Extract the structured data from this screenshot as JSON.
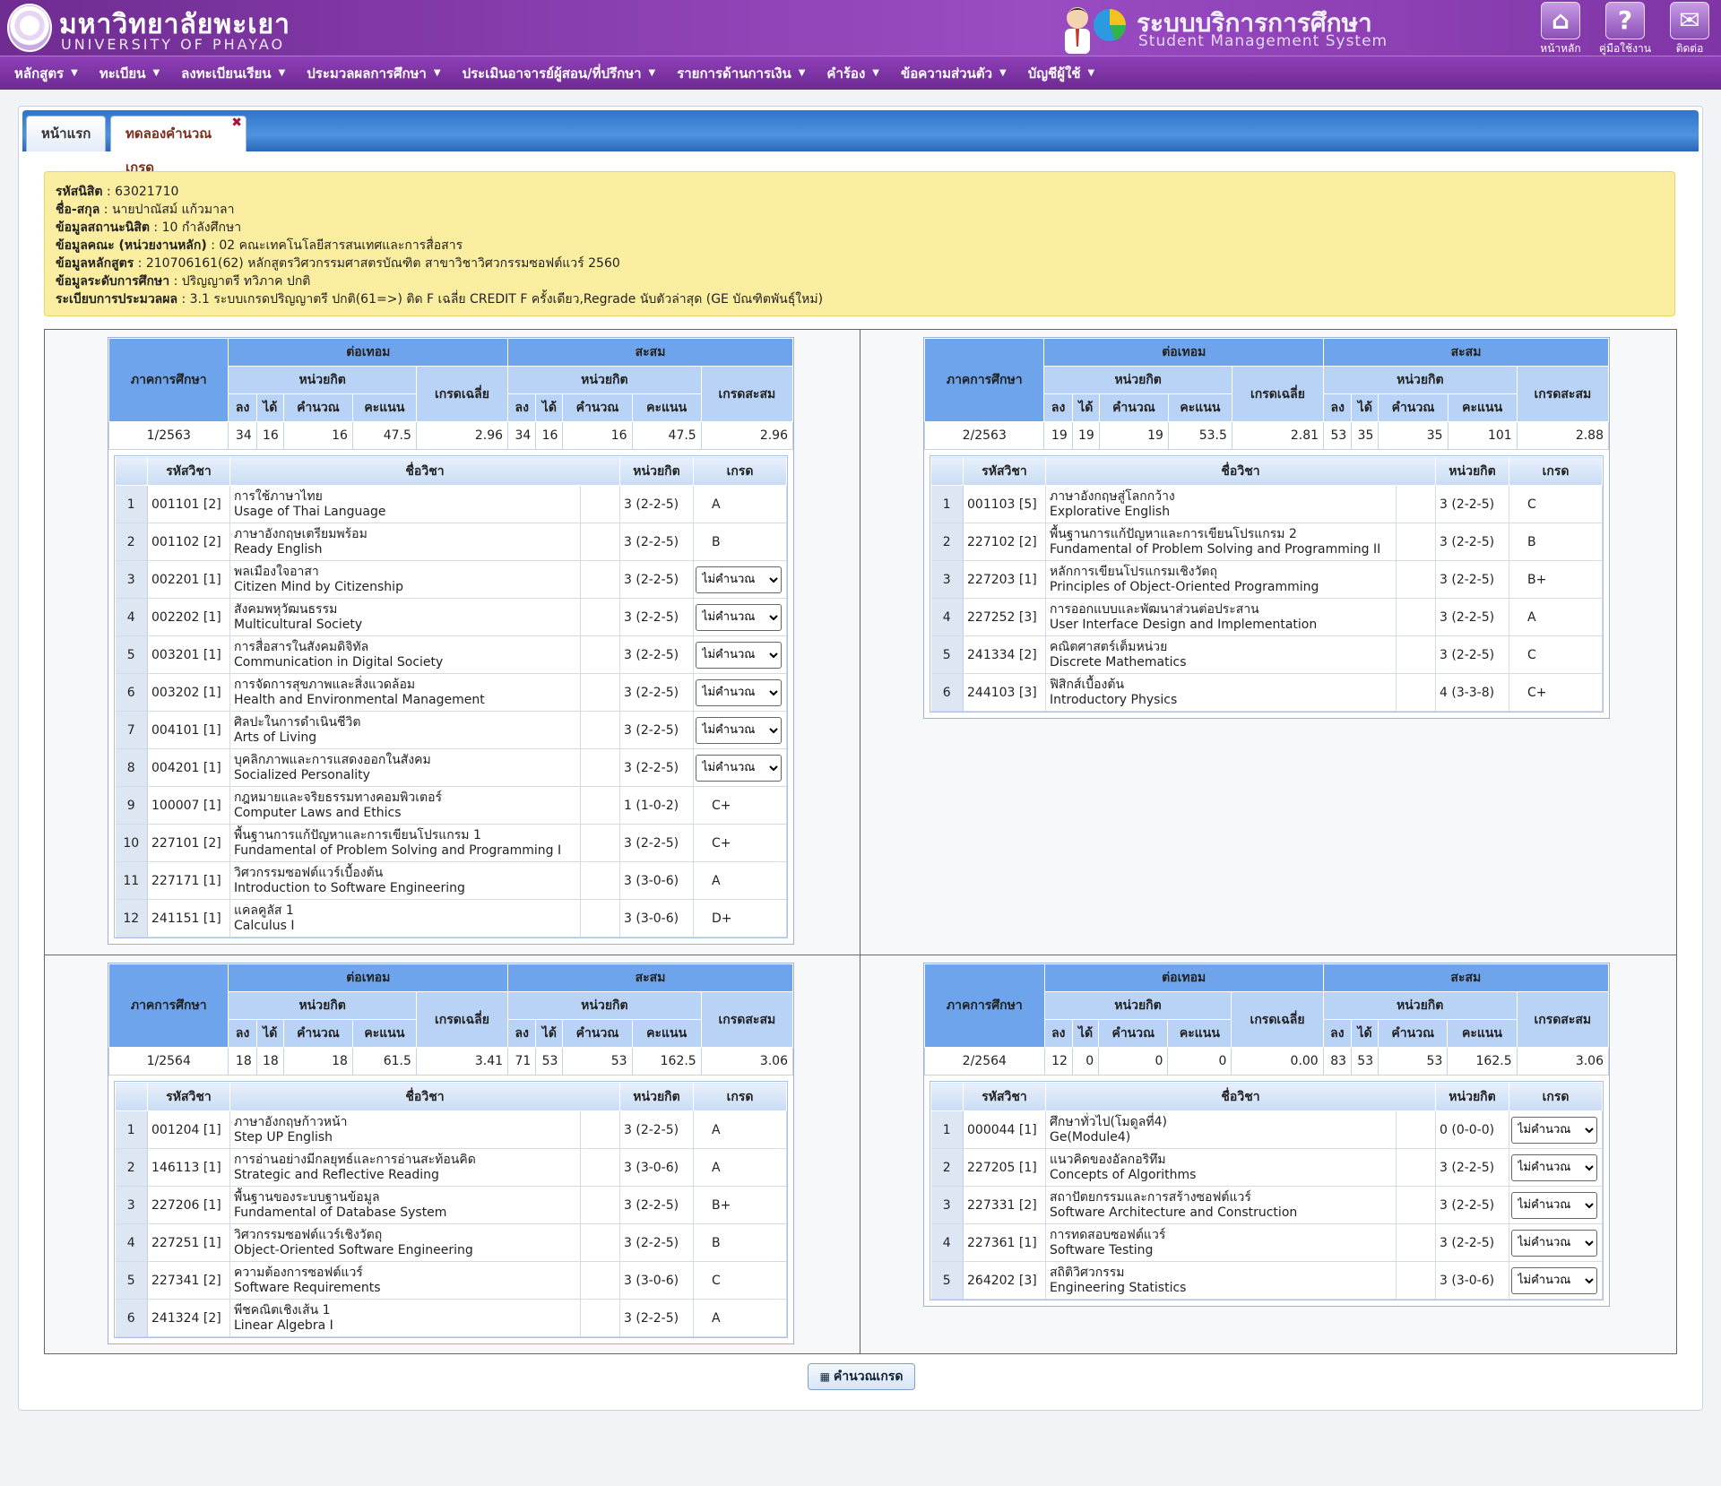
{
  "header": {
    "univ_th": "มหาวิทยาลัยพะเยา",
    "univ_en": "UNIVERSITY OF PHAYAO",
    "system_th": "ระบบบริการการศึกษา",
    "system_en": "Student Management System",
    "icons": [
      {
        "label": "หน้าหลัก",
        "icon": "home-icon",
        "glyph": "⌂"
      },
      {
        "label": "คู่มือใช้งาน",
        "icon": "help-icon",
        "glyph": "?"
      },
      {
        "label": "ติดต่อ",
        "icon": "mail-icon",
        "glyph": "✉"
      }
    ]
  },
  "menu": [
    "หลักสูตร",
    "ทะเบียน",
    "ลงทะเบียนเรียน",
    "ประมวลผลการศึกษา",
    "ประเมินอาจารย์ผู้สอน/ที่ปรึกษา",
    "รายการด้านการเงิน",
    "คำร้อง",
    "ข้อความส่วนตัว",
    "บัญชีผู้ใช้"
  ],
  "tabs": {
    "home": "หน้าแรก",
    "calc": "ทดลองคำนวณเกรด",
    "close": "✖"
  },
  "student": [
    {
      "label": "รหัสนิสิต",
      "value": "63021710"
    },
    {
      "label": "ชื่อ-สกุล",
      "value": "นายปาณัสม์ แก้วมาลา"
    },
    {
      "label": "ข้อมูลสถานะนิสิต",
      "value": "10 กำลังศึกษา"
    },
    {
      "label": "ข้อมูลคณะ (หน่วยงานหลัก)",
      "value": "02 คณะเทคโนโลยีสารสนเทศและการสื่อสาร"
    },
    {
      "label": "ข้อมูลหลักสูตร",
      "value": "210706161(62) หลักสูตรวิศวกรรมศาสตรบัณฑิต สาขาวิชาวิศวกรรมซอฟต์แวร์ 2560"
    },
    {
      "label": "ข้อมูลระดับการศึกษา",
      "value": "ปริญญาตรี ทวิภาค ปกติ"
    },
    {
      "label": "ระเบียบการประมวลผล",
      "value": "3.1 ระบบเกรดปริญญาตรี ปกติ(61=>) ติด F เฉลี่ย CREDIT F ครั้งเดียว,Regrade นับตัวล่าสุด (GE บัณฑิตพันธุ์ใหม่)"
    }
  ],
  "headers": {
    "semester": "ภาคการศึกษา",
    "term": "ต่อเทอม",
    "cumulative": "สะสม",
    "credits": "หน่วยกิต",
    "reg": "ลง",
    "got": "ได้",
    "calc": "คำนวณ",
    "points": "คะแนน",
    "gpa": "เกรดเฉลี่ย",
    "gpax": "เกรดสะสม",
    "code": "รหัสวิชา",
    "name": "ชื่อวิชา",
    "unit": "หน่วยกิต",
    "grade": "เกรด"
  },
  "select_text": "ไม่คำนวณ",
  "semesters": [
    {
      "name": "1/2563",
      "sum": [
        "34",
        "16",
        "16",
        "47.5",
        "2.96",
        "34",
        "16",
        "16",
        "47.5",
        "2.96"
      ],
      "courses": [
        {
          "code": "001101 [2]",
          "th": "การใช้ภาษาไทย",
          "en": "Usage of Thai Language",
          "unit": "3 (2-2-5)",
          "grade": "A"
        },
        {
          "code": "001102 [2]",
          "th": "ภาษาอังกฤษเตรียมพร้อม",
          "en": "Ready English",
          "unit": "3 (2-2-5)",
          "grade": "B"
        },
        {
          "code": "002201 [1]",
          "th": "พลเมืองใจอาสา",
          "en": "Citizen Mind by Citizenship",
          "unit": "3 (2-2-5)",
          "grade": "ไม่คำนวณ",
          "select": true
        },
        {
          "code": "002202 [1]",
          "th": "สังคมพหุวัฒนธรรม",
          "en": "Multicultural Society",
          "unit": "3 (2-2-5)",
          "grade": "ไม่คำนวณ",
          "select": true
        },
        {
          "code": "003201 [1]",
          "th": "การสื่อสารในสังคมดิจิทัล",
          "en": "Communication in Digital Society",
          "unit": "3 (2-2-5)",
          "grade": "ไม่คำนวณ",
          "select": true
        },
        {
          "code": "003202 [1]",
          "th": "การจัดการสุขภาพและสิ่งแวดล้อม",
          "en": "Health and Environmental Management",
          "unit": "3 (2-2-5)",
          "grade": "ไม่คำนวณ",
          "select": true
        },
        {
          "code": "004101 [1]",
          "th": "ศิลปะในการดำเนินชีวิต",
          "en": "Arts of Living",
          "unit": "3 (2-2-5)",
          "grade": "ไม่คำนวณ",
          "select": true
        },
        {
          "code": "004201 [1]",
          "th": "บุคลิกภาพและการแสดงออกในสังคม",
          "en": "Socialized Personality",
          "unit": "3 (2-2-5)",
          "grade": "ไม่คำนวณ",
          "select": true
        },
        {
          "code": "100007 [1]",
          "th": "กฎหมายและจริยธรรมทางคอมพิวเตอร์",
          "en": "Computer Laws and Ethics",
          "unit": "1 (1-0-2)",
          "grade": "C+"
        },
        {
          "code": "227101 [2]",
          "th": "พื้นฐานการแก้ปัญหาและการเขียนโปรแกรม 1",
          "en": "Fundamental of Problem Solving and Programming I",
          "unit": "3 (2-2-5)",
          "grade": "C+"
        },
        {
          "code": "227171 [1]",
          "th": "วิศวกรรมซอฟต์แวร์เบื้องต้น",
          "en": "Introduction to Software Engineering",
          "unit": "3 (3-0-6)",
          "grade": "A"
        },
        {
          "code": "241151 [1]",
          "th": "แคลคูลัส 1",
          "en": "Calculus I",
          "unit": "3 (3-0-6)",
          "grade": "D+"
        }
      ]
    },
    {
      "name": "2/2563",
      "sum": [
        "19",
        "19",
        "19",
        "53.5",
        "2.81",
        "53",
        "35",
        "35",
        "101",
        "2.88"
      ],
      "courses": [
        {
          "code": "001103 [5]",
          "th": "ภาษาอังกฤษสู่โลกกว้าง",
          "en": "Explorative English",
          "unit": "3 (2-2-5)",
          "grade": "C"
        },
        {
          "code": "227102 [2]",
          "th": "พื้นฐานการแก้ปัญหาและการเขียนโปรแกรม 2",
          "en": "Fundamental of Problem Solving and Programming II",
          "unit": "3 (2-2-5)",
          "grade": "B"
        },
        {
          "code": "227203 [1]",
          "th": "หลักการเขียนโปรแกรมเชิงวัตถุ",
          "en": "Principles of Object-Oriented Programming",
          "unit": "3 (2-2-5)",
          "grade": "B+"
        },
        {
          "code": "227252 [3]",
          "th": "การออกแบบและพัฒนาส่วนต่อประสาน",
          "en": "User Interface Design and Implementation",
          "unit": "3 (2-2-5)",
          "grade": "A"
        },
        {
          "code": "241334 [2]",
          "th": "คณิตศาสตร์เต็มหน่วย",
          "en": "Discrete Mathematics",
          "unit": "3 (2-2-5)",
          "grade": "C"
        },
        {
          "code": "244103 [3]",
          "th": "ฟิสิกส์เบื้องต้น",
          "en": "Introductory Physics",
          "unit": "4 (3-3-8)",
          "grade": "C+"
        }
      ]
    },
    {
      "name": "1/2564",
      "sum": [
        "18",
        "18",
        "18",
        "61.5",
        "3.41",
        "71",
        "53",
        "53",
        "162.5",
        "3.06"
      ],
      "courses": [
        {
          "code": "001204 [1]",
          "th": "ภาษาอังกฤษก้าวหน้า",
          "en": "Step UP English",
          "unit": "3 (2-2-5)",
          "grade": "A"
        },
        {
          "code": "146113 [1]",
          "th": "การอ่านอย่างมีกลยุทธ์และการอ่านสะท้อนคิด",
          "en": "Strategic and Reflective Reading",
          "unit": "3 (3-0-6)",
          "grade": "A"
        },
        {
          "code": "227206 [1]",
          "th": "พื้นฐานของระบบฐานข้อมูล",
          "en": "Fundamental of Database System",
          "unit": "3 (2-2-5)",
          "grade": "B+"
        },
        {
          "code": "227251 [1]",
          "th": "วิศวกรรมซอฟต์แวร์เชิงวัตถุ",
          "en": "Object-Oriented Software Engineering",
          "unit": "3 (2-2-5)",
          "grade": "B"
        },
        {
          "code": "227341 [2]",
          "th": "ความต้องการซอฟต์แวร์",
          "en": "Software Requirements",
          "unit": "3 (3-0-6)",
          "grade": "C"
        },
        {
          "code": "241324 [2]",
          "th": "พีชคณิตเชิงเส้น 1",
          "en": "Linear Algebra I",
          "unit": "3 (2-2-5)",
          "grade": "A"
        }
      ]
    },
    {
      "name": "2/2564",
      "sum": [
        "12",
        "0",
        "0",
        "0",
        "0.00",
        "83",
        "53",
        "53",
        "162.5",
        "3.06"
      ],
      "courses": [
        {
          "code": "000044 [1]",
          "th": "ศึกษาทั่วไป(โมดูลที่4)",
          "en": "Ge(Module4)",
          "unit": "0 (0-0-0)",
          "grade": "ไม่คำนวณ",
          "select": true
        },
        {
          "code": "227205 [1]",
          "th": "แนวคิดของอัลกอริทึม",
          "en": "Concepts of Algorithms",
          "unit": "3 (2-2-5)",
          "grade": "ไม่คำนวณ",
          "select": true
        },
        {
          "code": "227331 [2]",
          "th": "สถาปัตยกรรมและการสร้างซอฟต์แวร์",
          "en": "Software Architecture and Construction",
          "unit": "3 (2-2-5)",
          "grade": "ไม่คำนวณ",
          "select": true
        },
        {
          "code": "227361 [1]",
          "th": "การทดสอบซอฟต์แวร์",
          "en": "Software Testing",
          "unit": "3 (2-2-5)",
          "grade": "ไม่คำนวณ",
          "select": true
        },
        {
          "code": "264202 [3]",
          "th": "สถิติวิศวกรรม",
          "en": "Engineering Statistics",
          "unit": "3 (3-0-6)",
          "grade": "ไม่คำนวณ",
          "select": true
        }
      ]
    }
  ],
  "calc_button": "คำนวณเกรด"
}
